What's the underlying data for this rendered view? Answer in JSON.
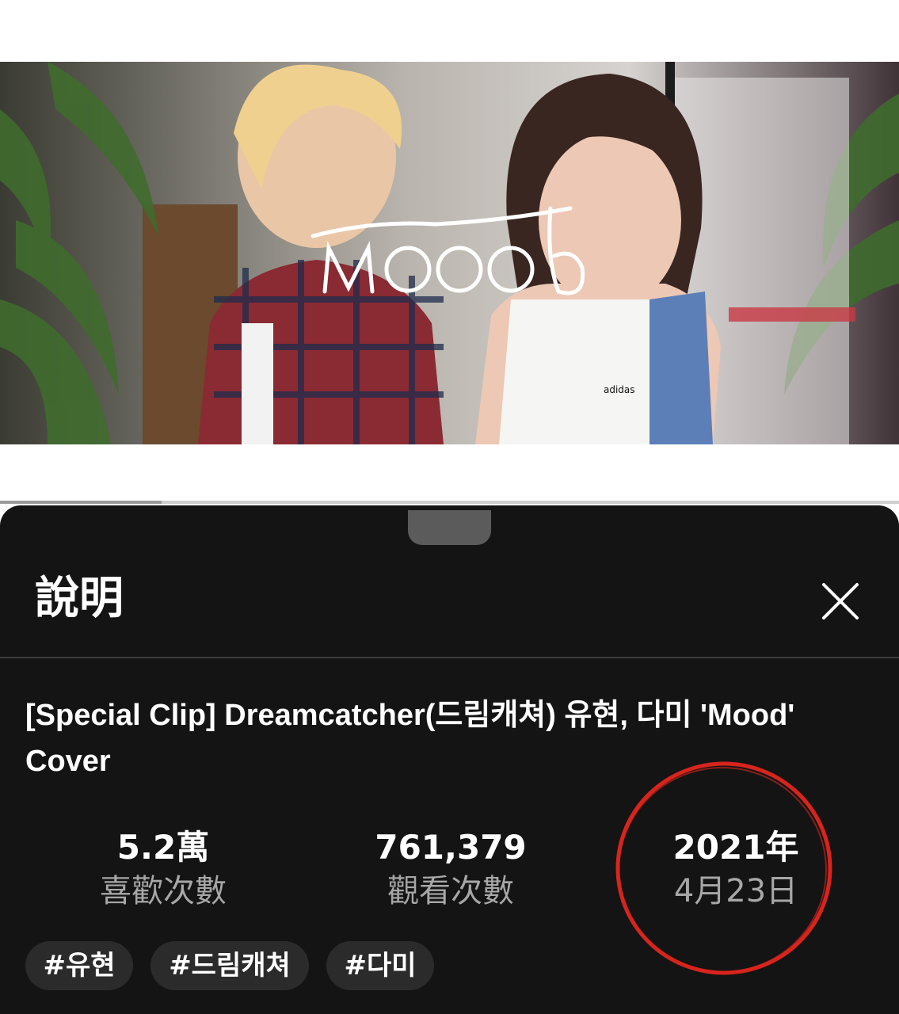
{
  "sheet": {
    "title": "說明",
    "close_icon": "close-icon"
  },
  "video": {
    "thumbnail_text": "mood",
    "title": "[Special Clip] Dreamcatcher(드림캐쳐) 유현, 다미 'Mood' Cover",
    "progress_fraction": 0.18
  },
  "stats": [
    {
      "value": "5.2萬",
      "label": "喜歡次數"
    },
    {
      "value": "761,379",
      "label": "觀看次數"
    },
    {
      "value": "2021年",
      "label": "4月23日"
    }
  ],
  "tags": [
    "#유현",
    "#드림캐쳐",
    "#다미"
  ],
  "colors": {
    "sheet_background": "#141414",
    "annotation_circle": "#d7241d",
    "secondary_text": "#a7a7a7"
  }
}
